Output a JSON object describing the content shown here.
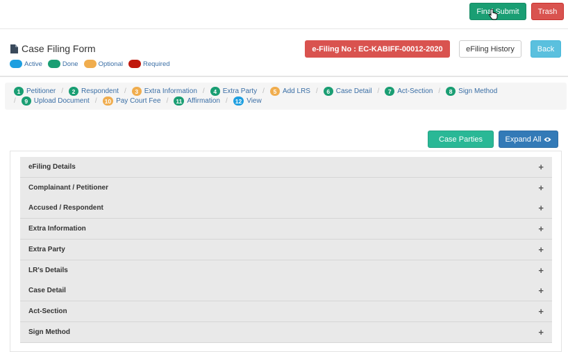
{
  "top_bar": {
    "final_submit": "Final Submit",
    "trash": "Trash"
  },
  "header": {
    "title": "Case Filing Form",
    "efiling_no": "e-Filing No : EC-KABIFF-00012-2020",
    "history": "eFiling History",
    "back": "Back",
    "legend": [
      {
        "label": "Active",
        "color": "#1e9fe0"
      },
      {
        "label": "Done",
        "color": "#1a9e73"
      },
      {
        "label": "Optional",
        "color": "#f0ad4e"
      },
      {
        "label": "Required",
        "color": "#c0180c"
      }
    ]
  },
  "steps": [
    {
      "num": "1",
      "label": "Petitioner",
      "color": "#1a9e73"
    },
    {
      "num": "2",
      "label": "Respondent",
      "color": "#1a9e73"
    },
    {
      "num": "3",
      "label": "Extra Information",
      "color": "#f0ad4e"
    },
    {
      "num": "4",
      "label": "Extra Party",
      "color": "#1a9e73"
    },
    {
      "num": "5",
      "label": "Add LRS",
      "color": "#f0ad4e"
    },
    {
      "num": "6",
      "label": "Case Detail",
      "color": "#1a9e73"
    },
    {
      "num": "7",
      "label": "Act-Section",
      "color": "#1a9e73"
    },
    {
      "num": "8",
      "label": "Sign Method",
      "color": "#1a9e73"
    },
    {
      "num": "9",
      "label": "Upload Document",
      "color": "#1a9e73"
    },
    {
      "num": "10",
      "label": "Pay Court Fee",
      "color": "#f0ad4e"
    },
    {
      "num": "11",
      "label": "Affirmation",
      "color": "#1a9e73"
    },
    {
      "num": "12",
      "label": "View",
      "color": "#1e9fe0"
    }
  ],
  "actions": {
    "case_parties": "Case Parties",
    "expand_all": "Expand All"
  },
  "accordion": [
    "eFiling Details",
    "Complainant / Petitioner",
    "Accused / Respondent",
    "Extra Information",
    "Extra Party",
    "LR's Details",
    "Case Detail",
    "Act-Section",
    "Sign Method"
  ]
}
